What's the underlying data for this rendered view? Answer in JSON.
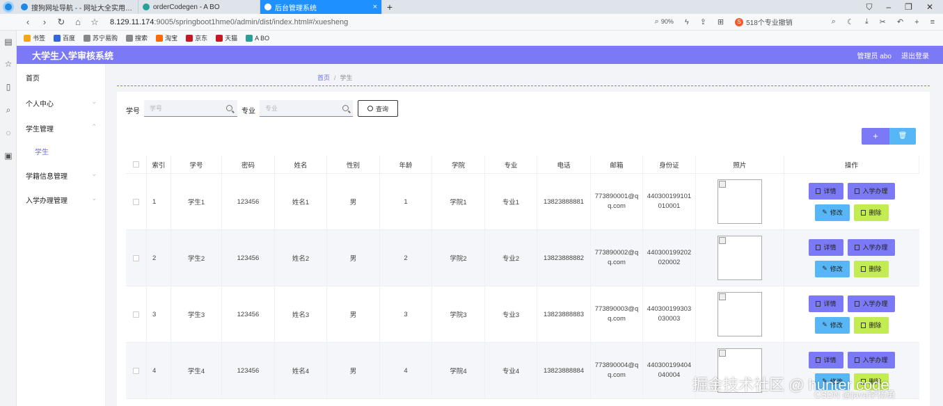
{
  "browser": {
    "tabs": [
      {
        "label": "搜狗网址导航 - - 网址大全实用网址",
        "fav_color": "#1e88e5",
        "active": false
      },
      {
        "label": "orderCodegen - A BO",
        "fav_color": "#2aa198",
        "active": false
      },
      {
        "label": "后台管理系统",
        "fav_color": "#2aa198",
        "active": true
      }
    ],
    "new_tab": "+",
    "url_host": "8.129.11.174",
    "url_rest": ":9005/springboot1hme0/admin/dist/index.html#/xuesheng",
    "zoom": "90%",
    "search_hint": "518个专业撤销",
    "bookmarks": [
      {
        "label": "书签",
        "color": "#f3a712"
      },
      {
        "label": "百度",
        "color": "#3366dd"
      },
      {
        "label": "苏宁易购",
        "color": "#888888"
      },
      {
        "label": "搜索",
        "color": "#888888"
      },
      {
        "label": "淘宝",
        "color": "#ff6a00"
      },
      {
        "label": "京东",
        "color": "#c81623"
      },
      {
        "label": "天猫",
        "color": "#c81623"
      },
      {
        "label": "A BO",
        "color": "#2aa198"
      }
    ]
  },
  "app": {
    "title": "大学生入学审核系统",
    "user": "管理员 abo",
    "logout": "退出登录",
    "accent": "#7b79f5"
  },
  "sidebar": {
    "items": [
      {
        "label": "首页",
        "chevron": false
      },
      {
        "label": "个人中心",
        "chevron": true
      },
      {
        "label": "学生管理",
        "chevron": true
      },
      {
        "label": "学籍信息管理",
        "chevron": true
      },
      {
        "label": "入学办理管理",
        "chevron": true
      }
    ],
    "sub_item": "学生"
  },
  "breadcrumb": {
    "home": "首页",
    "sep": "/",
    "current": "学生"
  },
  "search": {
    "student_no_label": "学号",
    "student_no_placeholder": "学号",
    "major_label": "专业",
    "major_placeholder": "专业",
    "query_label": "查询"
  },
  "toolbar": {
    "add": "+",
    "delete": "🗑"
  },
  "table": {
    "headers": [
      "",
      "索引",
      "学号",
      "密码",
      "姓名",
      "性别",
      "年龄",
      "学院",
      "专业",
      "电话",
      "邮箱",
      "身份证",
      "照片",
      "操作"
    ],
    "rows": [
      {
        "index": "1",
        "no": "学生1",
        "pwd": "123456",
        "name": "姓名1",
        "gender": "男",
        "age": "1",
        "college": "学院1",
        "major": "专业1",
        "phone": "13823888881",
        "email": "773890001@qq.com",
        "idcard": "440300199101010001"
      },
      {
        "index": "2",
        "no": "学生2",
        "pwd": "123456",
        "name": "姓名2",
        "gender": "男",
        "age": "2",
        "college": "学院2",
        "major": "专业2",
        "phone": "13823888882",
        "email": "773890002@qq.com",
        "idcard": "440300199202020002"
      },
      {
        "index": "3",
        "no": "学生3",
        "pwd": "123456",
        "name": "姓名3",
        "gender": "男",
        "age": "3",
        "college": "学院3",
        "major": "专业3",
        "phone": "13823888883",
        "email": "773890003@qq.com",
        "idcard": "440300199303030003"
      },
      {
        "index": "4",
        "no": "学生4",
        "pwd": "123456",
        "name": "姓名4",
        "gender": "男",
        "age": "4",
        "college": "学院4",
        "major": "专业4",
        "phone": "13823888884",
        "email": "773890004@qq.com",
        "idcard": "440300199404040004"
      }
    ],
    "actions": {
      "detail": "详情",
      "enroll": "入学办理",
      "edit": "修改",
      "delete": "删除"
    }
  },
  "watermark": {
    "main": "掘金技术社区 @ hunter code",
    "sub": "CSDN @java李杨勇"
  }
}
